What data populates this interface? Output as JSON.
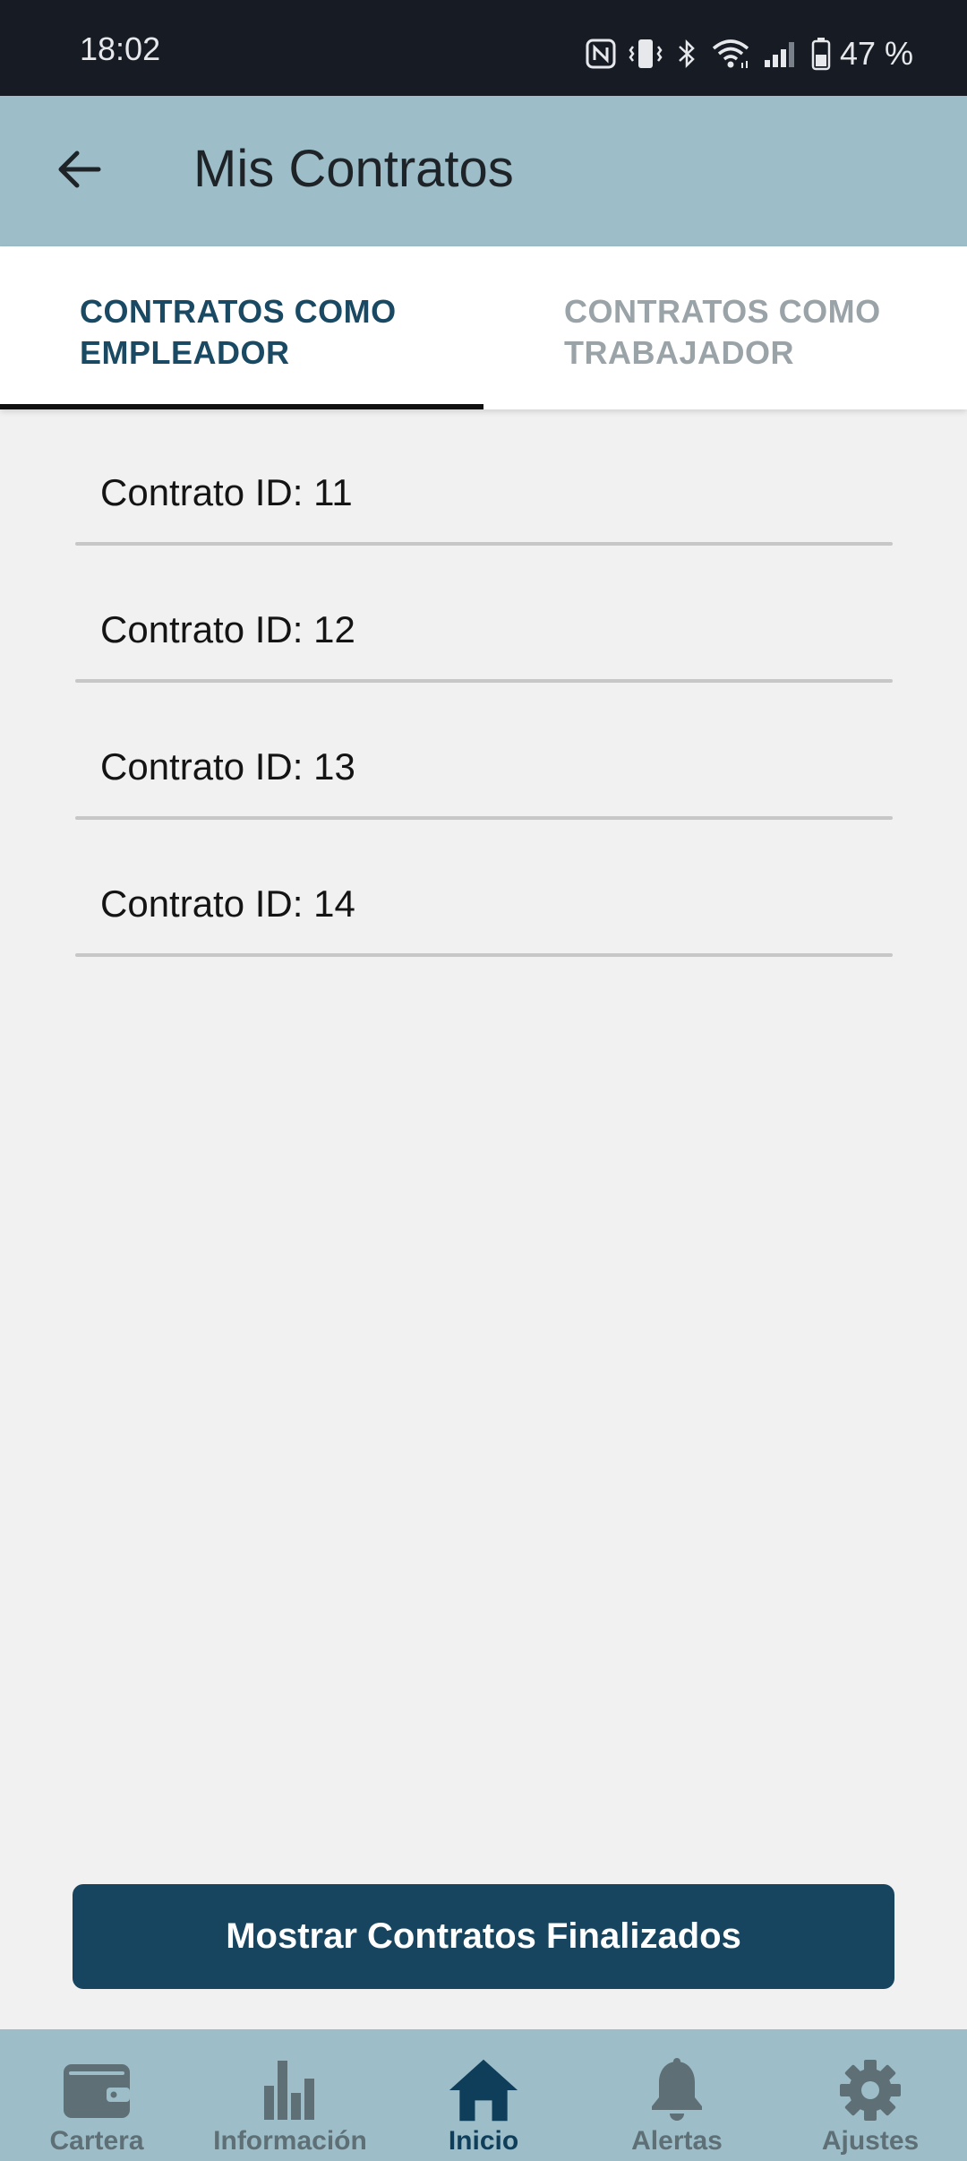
{
  "status_bar": {
    "time": "18:02",
    "battery": "47 %",
    "icons": [
      "nfc-icon",
      "vibrate-icon",
      "bluetooth-icon",
      "wifi-icon",
      "signal-icon",
      "battery-icon"
    ]
  },
  "app_bar": {
    "title": "Mis Contratos",
    "back_icon": "arrow-left-icon"
  },
  "tabs": [
    {
      "line1": "CONTRATOS COMO",
      "line2": "EMPLEADOR",
      "active": true
    },
    {
      "line1": "CONTRATOS COMO",
      "line2": "TRABAJADOR",
      "active": false
    }
  ],
  "contracts": [
    {
      "label": "Contrato ID: 11"
    },
    {
      "label": "Contrato ID: 12"
    },
    {
      "label": "Contrato ID: 13"
    },
    {
      "label": "Contrato ID: 14"
    }
  ],
  "finished_button": {
    "label": "Mostrar Contratos Finalizados"
  },
  "bottom_nav": [
    {
      "label": "Cartera",
      "icon": "wallet-icon",
      "active": false
    },
    {
      "label": "Información",
      "icon": "bar-chart-icon",
      "active": false
    },
    {
      "label": "Inicio",
      "icon": "home-icon",
      "active": true
    },
    {
      "label": "Alertas",
      "icon": "bell-icon",
      "active": false
    },
    {
      "label": "Ajustes",
      "icon": "gear-icon",
      "active": false
    }
  ],
  "colors": {
    "status_bar_bg": "#161b24",
    "app_bar_bg": "#9dbdc8",
    "accent": "#17455f",
    "active_tab_text": "#1a4a63",
    "inactive_tab_text": "#9aa3a8",
    "background": "#f1f1f1"
  }
}
